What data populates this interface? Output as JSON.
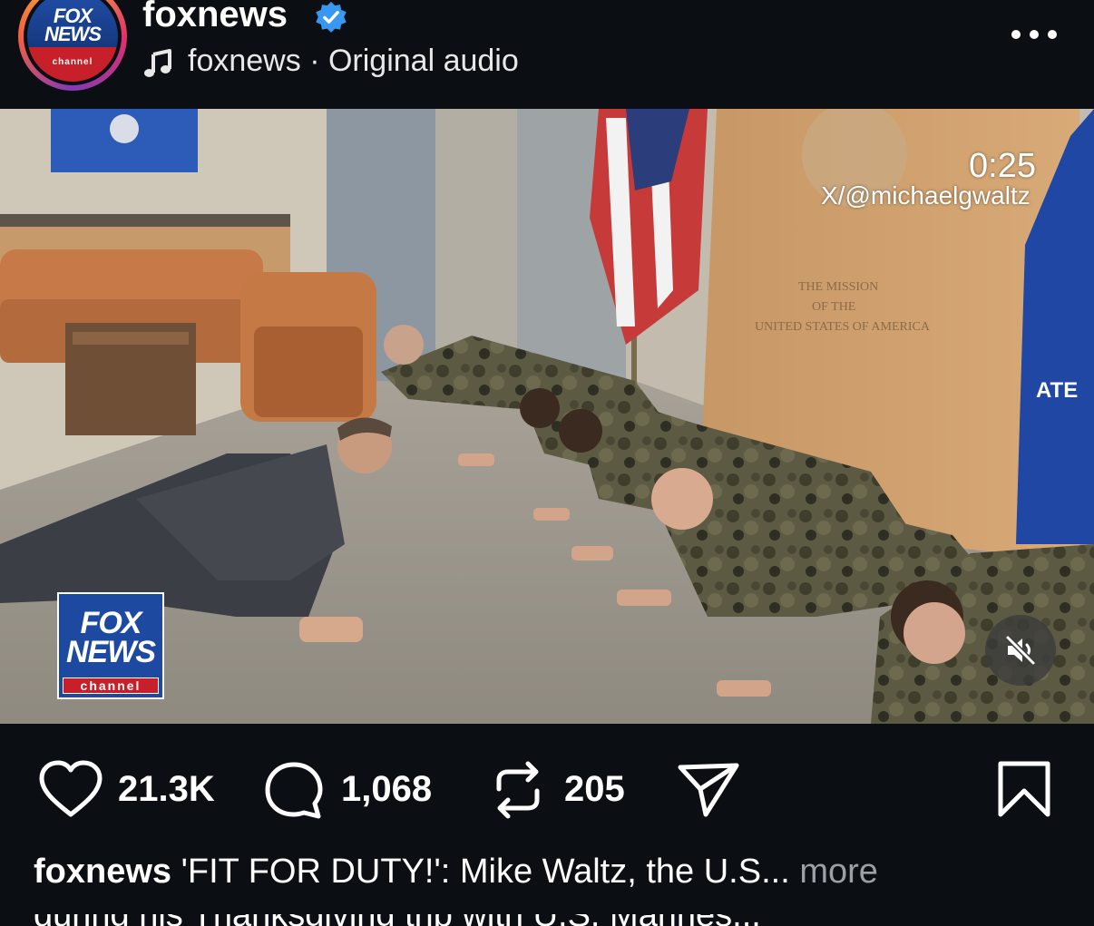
{
  "header": {
    "username": "foxnews",
    "audio_owner": "foxnews",
    "separator": "·",
    "audio_label": "Original audio",
    "avatar": {
      "logo_line1": "FOX",
      "logo_line2": "NEWS",
      "logo_line3": "channel"
    },
    "icons": [
      "verified-badge-icon",
      "music-note-icon",
      "more-options-icon"
    ],
    "colors": {
      "verified": "#3897f0",
      "fox_blue": "#1d4aa0",
      "fox_red": "#c8202a"
    }
  },
  "video": {
    "timestamp": "0:25",
    "source_handle": "X/@michaelgwaltz",
    "watermark": {
      "line1": "FOX",
      "line2": "NEWS",
      "line3": "channel"
    },
    "sign_text": [
      "THE MISSION",
      "OF THE",
      "UNITED STATES OF AMERICA"
    ],
    "flag_text": "ATE",
    "muted": true
  },
  "actions": {
    "likes": "21.3K",
    "comments": "1,068",
    "reposts": "205",
    "icons": [
      "heart-icon",
      "comment-icon",
      "repost-icon",
      "share-icon",
      "bookmark-icon"
    ]
  },
  "caption": {
    "username": "foxnews",
    "text": "'FIT FOR DUTY!': Mike Waltz, the U.S...",
    "more": "more",
    "next_line": "during his Thanksgiving trip with U.S. Marines..."
  }
}
